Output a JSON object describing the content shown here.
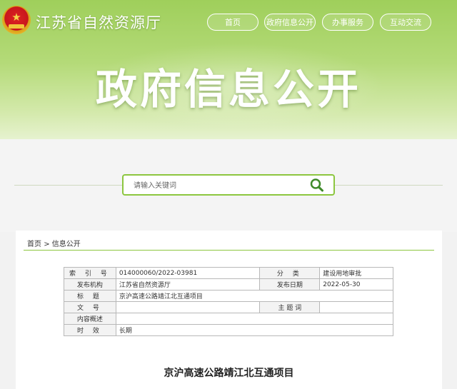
{
  "header": {
    "site_name": "江苏省自然资源厅",
    "nav": [
      "首页",
      "政府信息公开",
      "办事服务",
      "互动交流"
    ],
    "banner_title": "政府信息公开"
  },
  "search": {
    "placeholder": "请输入关键词"
  },
  "breadcrumb": {
    "home": "首页",
    "separator": ">",
    "current": "信息公开"
  },
  "meta": {
    "index_label": "索 引 号",
    "index_value": "014000060/2022-03981",
    "category_label": "分 类",
    "category_value": "建设用地审批",
    "publisher_label": "发布机构",
    "publisher_value": "江苏省自然资源厅",
    "date_label": "发布日期",
    "date_value": "2022-05-30",
    "title_label": "标 题",
    "title_value": "京沪高速公路靖江北互通项目",
    "docno_label": "文 号",
    "docno_value": "",
    "subject_label": "主 题 词",
    "subject_value": "",
    "summary_label": "内容概述",
    "summary_value": "",
    "validity_label": "时 效",
    "validity_value": "长期"
  },
  "document": {
    "title": "京沪高速公路靖江北互通项目"
  },
  "colors": {
    "accent": "#8cc63f",
    "banner_top": "#9fcf5b",
    "emblem_red": "#c8161d"
  }
}
